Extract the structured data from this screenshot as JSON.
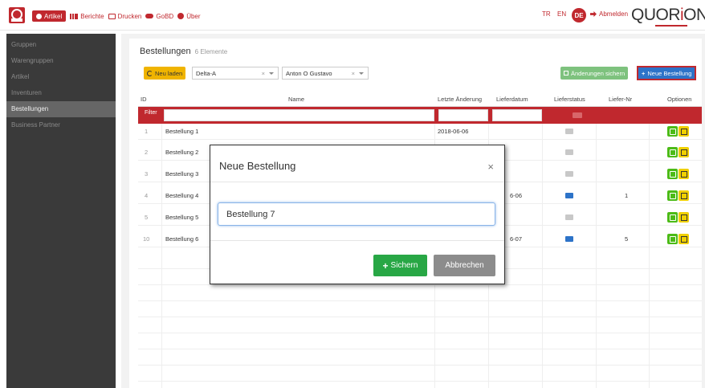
{
  "nav": {
    "items": [
      {
        "label": "Artikel",
        "icon": "clock-icon",
        "active": true
      },
      {
        "label": "Berichte",
        "icon": "chart-icon"
      },
      {
        "label": "Drucken",
        "icon": "printer-icon"
      },
      {
        "label": "GoBD",
        "icon": "cloud-icon"
      },
      {
        "label": "Über",
        "icon": "info-icon"
      }
    ],
    "lang_tr": "TR",
    "lang_en": "EN",
    "lang_de": "DE",
    "logout": "Abmelden",
    "brand_left": "QUOR",
    "brand_dot": "i",
    "brand_right": "ON"
  },
  "sidebar": {
    "items": [
      {
        "label": "Gruppen"
      },
      {
        "label": "Warengruppen"
      },
      {
        "label": "Artikel"
      },
      {
        "label": "Inventuren"
      },
      {
        "label": "Bestellungen",
        "active": true
      },
      {
        "label": "Business Partner"
      }
    ]
  },
  "panel": {
    "title": "Bestellungen",
    "count": "6 Elemente",
    "reload_label": "Neu laden",
    "select1": "Delta-A",
    "select2": "Anton O Gustavo",
    "clear": "×",
    "save_changes": "Änderungen sichern",
    "new_order": "Neue Bestellung"
  },
  "table": {
    "headers": {
      "id": "ID",
      "name": "Name",
      "changed": "Letzte Änderung",
      "delivery": "Lieferdatum",
      "status": "Lieferstatus",
      "number": "Liefer-Nr",
      "options": "Optionen"
    },
    "filter_label": "Filter",
    "rows": [
      {
        "id": "1",
        "name": "Bestellung 1",
        "changed": "2018-06-06",
        "delivery": "",
        "status": "grey",
        "number": ""
      },
      {
        "id": "2",
        "name": "Bestellung 2",
        "changed": "",
        "delivery": "",
        "status": "grey",
        "number": ""
      },
      {
        "id": "3",
        "name": "Bestellung 3",
        "changed": "",
        "delivery": "",
        "status": "grey",
        "number": ""
      },
      {
        "id": "4",
        "name": "Bestellung 4",
        "changed": "",
        "delivery": "6-06",
        "status": "blue",
        "number": "1"
      },
      {
        "id": "5",
        "name": "Bestellung 5",
        "changed": "",
        "delivery": "",
        "status": "grey",
        "number": ""
      },
      {
        "id": "10",
        "name": "Bestellung 6",
        "changed": "",
        "delivery": "6-07",
        "status": "blue",
        "number": "5"
      }
    ]
  },
  "modal": {
    "title": "Neue Bestellung",
    "close": "×",
    "input_value": "Bestellung 7",
    "save": "Sichern",
    "cancel": "Abbrechen"
  },
  "colors": {
    "brand": "#c0282e",
    "primary": "#2d73c8",
    "success": "#28a745",
    "warning": "#f0b400"
  }
}
